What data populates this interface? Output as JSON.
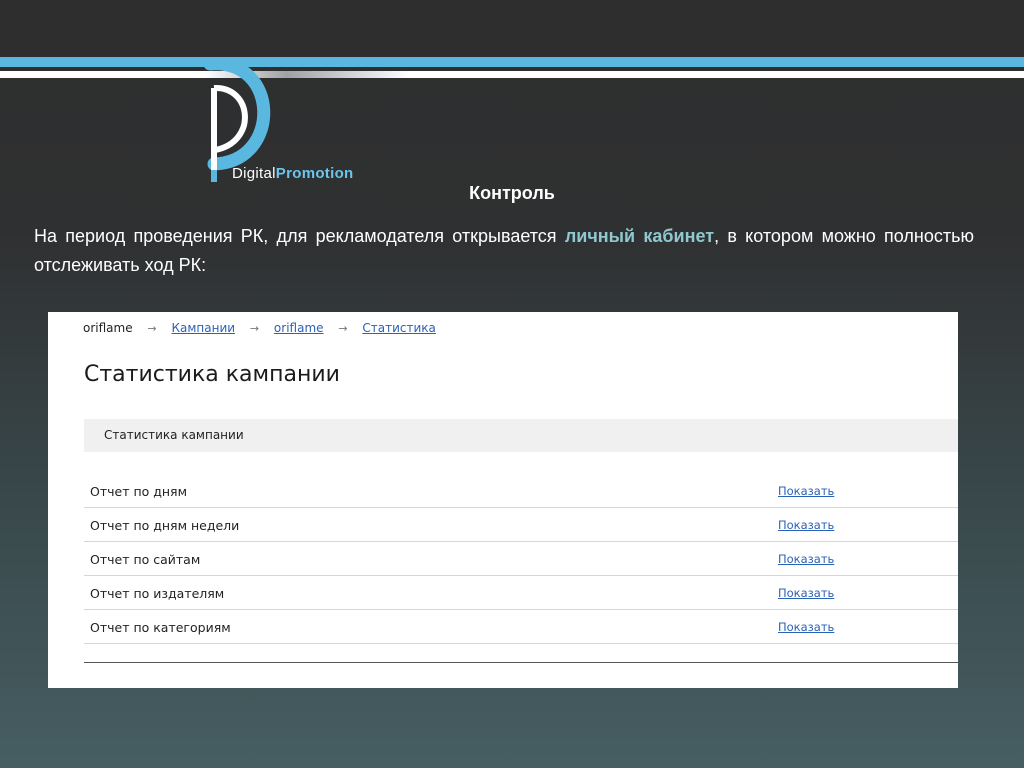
{
  "logo": {
    "word_plain": "Digital",
    "word_bold": "Promotion",
    "brand_blue": "#5ab8e0",
    "brand_text_blue": "#6cc6ec"
  },
  "slide": {
    "title": "Контроль",
    "intro_before": "На период проведения РК, для рекламодателя открывается ",
    "intro_highlight": "личный кабинет",
    "intro_after": ", в котором можно полностью отслеживать ход РК:",
    "highlight_color": "#8fc8cf"
  },
  "screenshot": {
    "breadcrumb": {
      "root": "oriflame",
      "links": [
        "Кампании",
        "oriflame",
        "Статистика"
      ],
      "separator": "→"
    },
    "heading": "Статистика кампании",
    "section_label": "Статистика кампании",
    "link_color": "#2a62b8",
    "reports": [
      {
        "label": "Отчет по дням",
        "action": "Показать"
      },
      {
        "label": "Отчет по дням недели",
        "action": "Показать"
      },
      {
        "label": "Отчет по сайтам",
        "action": "Показать"
      },
      {
        "label": "Отчет по издателям",
        "action": "Показать"
      },
      {
        "label": "Отчет по категориям",
        "action": "Показать"
      }
    ]
  }
}
